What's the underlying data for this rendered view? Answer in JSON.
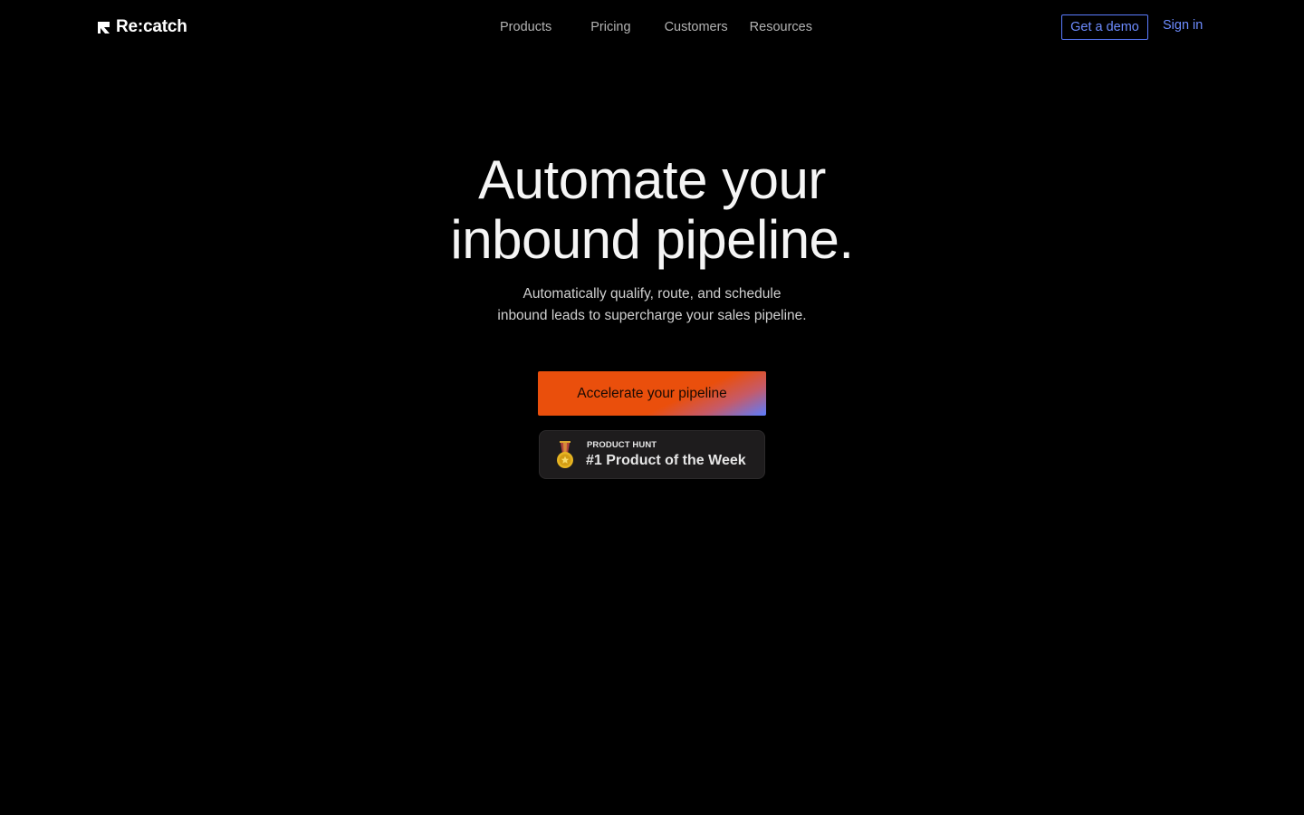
{
  "brand": {
    "name": "Re:catch"
  },
  "nav": {
    "items": [
      {
        "label": "Products"
      },
      {
        "label": "Pricing"
      },
      {
        "label": "Customers"
      },
      {
        "label": "Resources"
      }
    ]
  },
  "header_actions": {
    "demo_label": "Get a demo",
    "signin_label": "Sign in"
  },
  "hero": {
    "title_lines": [
      "Automate your",
      "inbound pipeline."
    ],
    "subtitle_lines": [
      "Automatically qualify, route, and schedule",
      "inbound leads to supercharge your sales pipeline."
    ],
    "cta_label": "Accelerate your pipeline"
  },
  "product_hunt_badge": {
    "kicker": "PRODUCT HUNT",
    "title": "#1 Product of the Week",
    "icon": "medal-icon"
  },
  "colors": {
    "background": "#000000",
    "accent_blue": "#6d8cff",
    "cta_orange": "#ea4f0c",
    "badge_bg": "#1e1c1d"
  }
}
